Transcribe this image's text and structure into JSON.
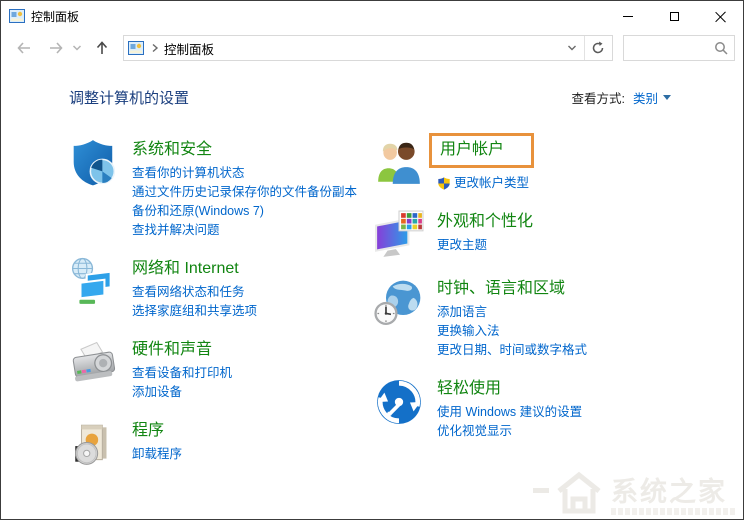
{
  "window": {
    "title": "控制面板"
  },
  "navbar": {
    "breadcrumb": "控制面板"
  },
  "header": {
    "title": "调整计算机的设置",
    "view_by_label": "查看方式:",
    "view_by_value": "类别"
  },
  "categories": {
    "left": [
      {
        "title": "系统和安全",
        "icon": "security-shield-icon",
        "links": [
          "查看你的计算机状态",
          "通过文件历史记录保存你的文件备份副本",
          "备份和还原(Windows 7)",
          "查找并解决问题"
        ]
      },
      {
        "title": "网络和 Internet",
        "icon": "network-internet-icon",
        "links": [
          "查看网络状态和任务",
          "选择家庭组和共享选项"
        ]
      },
      {
        "title": "硬件和声音",
        "icon": "hardware-sound-icon",
        "links": [
          "查看设备和打印机",
          "添加设备"
        ]
      },
      {
        "title": "程序",
        "icon": "programs-icon",
        "links": [
          "卸载程序"
        ]
      }
    ],
    "right": [
      {
        "title": "用户帐户",
        "icon": "user-accounts-icon",
        "highlighted": true,
        "links": [
          "更改帐户类型"
        ]
      },
      {
        "title": "外观和个性化",
        "icon": "appearance-personalization-icon",
        "links": [
          "更改主题"
        ]
      },
      {
        "title": "时钟、语言和区域",
        "icon": "clock-language-region-icon",
        "links": [
          "添加语言",
          "更换输入法",
          "更改日期、时间或数字格式"
        ]
      },
      {
        "title": "轻松使用",
        "icon": "ease-of-access-icon",
        "links": [
          "使用 Windows 建议的设置",
          "优化视觉显示"
        ]
      }
    ]
  },
  "watermark": {
    "text": "系统之家"
  },
  "colors": {
    "category_title_green": "#118511",
    "link_blue": "#0066cc",
    "heading_blue": "#1a3e7e",
    "highlight_orange": "#e8923c"
  }
}
